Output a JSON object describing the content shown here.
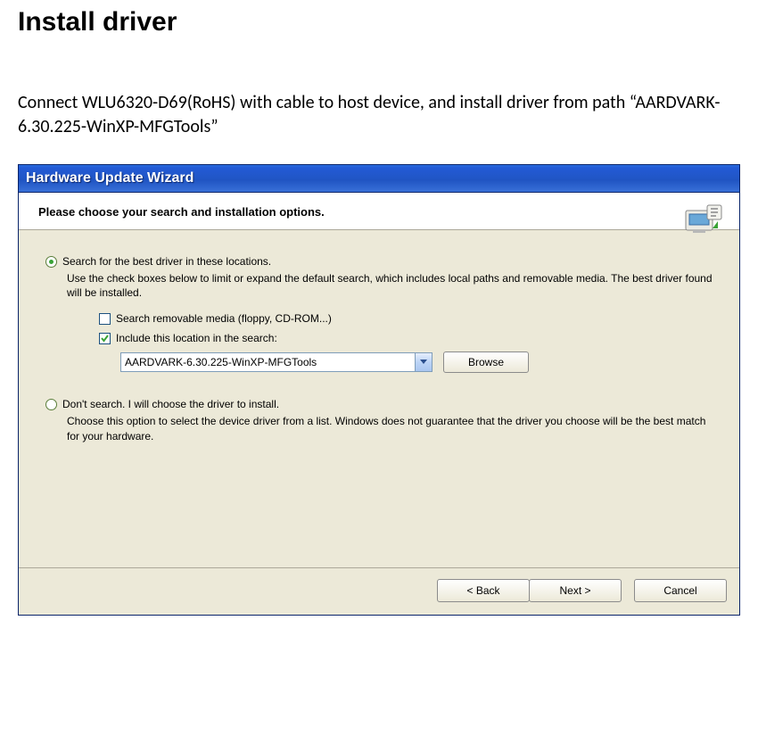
{
  "doc": {
    "heading": "Install driver",
    "body": "Connect WLU6320-D69(RoHS) with cable to host device, and install driver from path “AARDVARK-6.30.225-WinXP-MFGTools”"
  },
  "window": {
    "title": "Hardware Update Wizard",
    "header": "Please choose your search and installation options."
  },
  "options": {
    "radio1": {
      "label": "Search for the best driver in these locations.",
      "checked": true,
      "desc": "Use the check boxes below to limit or expand the default search, which includes local paths and removable media. The best driver found will be installed.",
      "check1": {
        "label": "Search removable media (floppy, CD-ROM...)",
        "checked": false
      },
      "check2": {
        "label": "Include this location in the search:",
        "checked": true
      },
      "path": "AARDVARK-6.30.225-WinXP-MFGTools",
      "browse": "Browse"
    },
    "radio2": {
      "label": "Don't search. I will choose the driver to install.",
      "checked": false,
      "desc": "Choose this option to select the device driver from a list.  Windows does not guarantee that the driver you choose will be the best match for your hardware."
    }
  },
  "buttons": {
    "back": "< Back",
    "next": "Next >",
    "cancel": "Cancel"
  }
}
